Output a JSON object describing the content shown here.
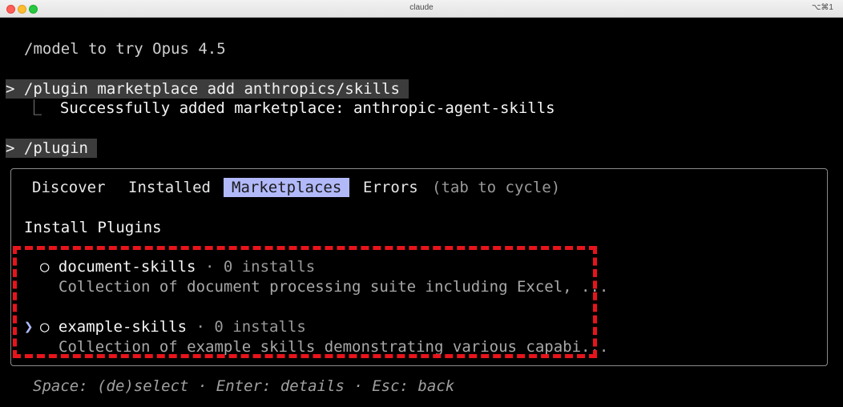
{
  "window": {
    "title": "claude",
    "shortcut": "⌥⌘1"
  },
  "terminal": {
    "hint_line": "/model to try Opus 4.5",
    "commands": [
      {
        "prompt": ">",
        "text": "/plugin marketplace add anthropics/skills",
        "result_glyph": "⎿",
        "result": "Successfully added marketplace: anthropic-agent-skills"
      },
      {
        "prompt": ">",
        "text": "/plugin"
      }
    ]
  },
  "plugin_panel": {
    "tabs": [
      {
        "label": "Discover",
        "active": false
      },
      {
        "label": "Installed",
        "active": false
      },
      {
        "label": "Marketplaces",
        "active": true
      },
      {
        "label": "Errors",
        "active": false
      }
    ],
    "tab_hint": "(tab to cycle)",
    "section_title": "Install Plugins",
    "plugins": [
      {
        "radio": "○",
        "name": "document-skills",
        "separator": "·",
        "installs": "0 installs",
        "description": "Collection of document processing suite including Excel, ...",
        "selected": false
      },
      {
        "radio": "○",
        "name": "example-skills",
        "separator": "·",
        "installs": "0 installs",
        "description": "Collection of example skills demonstrating various capabi...",
        "selected": true,
        "pointer": "❯"
      }
    ],
    "footer": "Space: (de)select · Enter: details · Esc: back"
  },
  "colors": {
    "active_tab_bg": "#b1b9f9",
    "highlight_border": "#e8141b",
    "command_bg": "#3c3c3c"
  }
}
